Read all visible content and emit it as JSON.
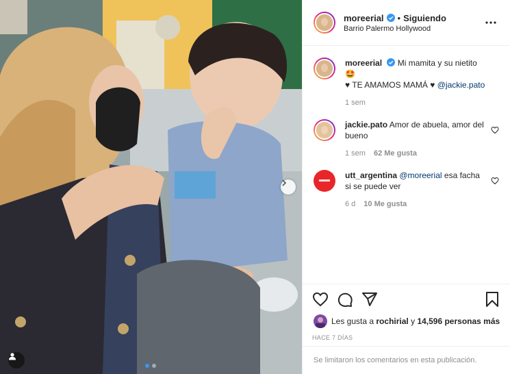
{
  "post": {
    "author": "moreerial",
    "follow_status": "Siguiendo",
    "separator": "•",
    "location": "Barrio Palermo Hollywood",
    "more_icon": "more-horizontal-icon",
    "verified_color": "#3897f0"
  },
  "caption": {
    "author": "moreerial",
    "text": "Mi mamita y su nietito🤩",
    "text2": "♥ TE AMAMOS MAMÁ ♥ ",
    "mention": "@jackie.pato",
    "time": "1 sem"
  },
  "comments": [
    {
      "author": "jackie.pato",
      "text": "Amor de abuela, amor del bueno",
      "time": "1 sem",
      "likes": "62 Me gusta"
    },
    {
      "author": "utt_argentina",
      "mention": "@moreerial",
      "text": " esa facha si se puede ver",
      "time": "6 d",
      "likes": "10 Me gusta"
    }
  ],
  "likes": {
    "prefix": "Les gusta a ",
    "user": "rochirial",
    "connector": " y ",
    "count": "14,596 personas más"
  },
  "time_ago": "HACE 7 DÍAS",
  "comments_limited": "Se limitaron los comentarios en esta publicación.",
  "carousel": {
    "slides": 2,
    "active": 1
  },
  "colors": {
    "link": "#00376b",
    "muted": "#8e8e8e",
    "accent": "#3897f0",
    "utt_red": "#e8262a"
  }
}
